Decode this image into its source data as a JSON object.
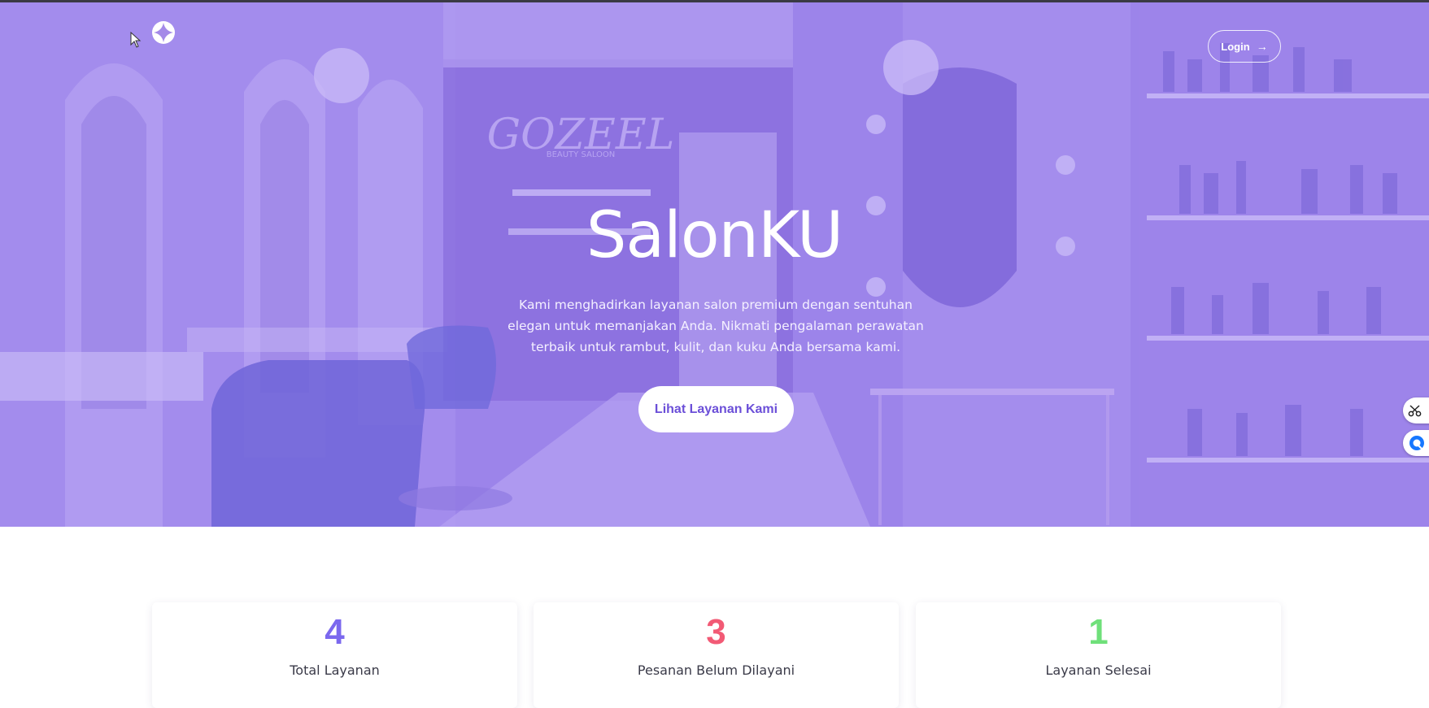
{
  "brand": {
    "name": "SalonKU"
  },
  "nav": {
    "login_label": "Login"
  },
  "hero": {
    "title": "SalonKU",
    "description": "Kami menghadirkan layanan salon premium dengan sentuhan elegan untuk memanjakan Anda. Nikmati pengalaman perawatan terbaik untuk rambut, kulit, dan kuku Anda bersama kami.",
    "cta_label": "Lihat Layanan Kami",
    "background_sign": "GOZEEL",
    "background_sign_sub": "BEAUTY SALOON"
  },
  "stats": [
    {
      "value": "4",
      "label": "Total Layanan",
      "color": "#7b68ee"
    },
    {
      "value": "3",
      "label": "Pesanan Belum Dilayani",
      "color": "#f25a75"
    },
    {
      "value": "1",
      "label": "Layanan Selesai",
      "color": "#6fe07a"
    }
  ],
  "colors": {
    "hero_overlay": "#9c84ea",
    "accent": "#6b4fd8"
  },
  "side_tools": [
    "scissors-icon",
    "chat-icon"
  ]
}
